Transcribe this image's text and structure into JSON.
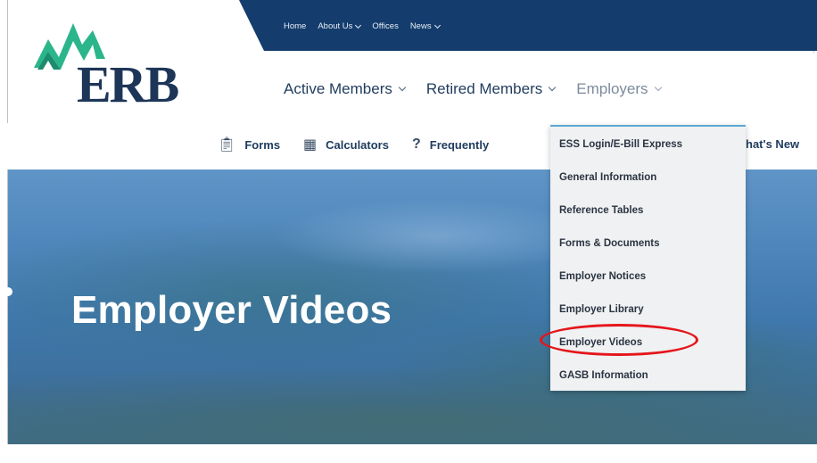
{
  "logo": {
    "text": "ERB",
    "peak_colors": [
      "#2bb58a",
      "#1d8c6e"
    ],
    "text_color": "#1d3557"
  },
  "utility_nav": [
    {
      "label": "Home",
      "has_dropdown": false
    },
    {
      "label": "About Us",
      "has_dropdown": true
    },
    {
      "label": "Offices",
      "has_dropdown": false
    },
    {
      "label": "News",
      "has_dropdown": true
    }
  ],
  "main_nav": [
    {
      "label": "Active Members",
      "has_dropdown": true
    },
    {
      "label": "Retired Members",
      "has_dropdown": true
    },
    {
      "label": "Employers",
      "has_dropdown": true,
      "state": "open"
    }
  ],
  "quick_links": [
    {
      "label": "Forms",
      "icon": "clipboard-icon"
    },
    {
      "label": "Calculators",
      "icon": "calculator-icon"
    },
    {
      "label": "Frequently",
      "icon": "question-icon"
    }
  ],
  "whats_new_partial": "hat's New",
  "hero": {
    "title": "Employer Videos"
  },
  "employers_menu": [
    "ESS Login/E-Bill Express",
    "General Information",
    "Reference Tables",
    "Forms & Documents",
    "Employer Notices",
    "Employer Library",
    "Employer Videos",
    "GASB Information"
  ],
  "annotation": {
    "circled_item": "Employer Videos",
    "color": "#e4161b"
  },
  "colors": {
    "utility_bar": "#143d6d",
    "nav_text": "#1f3b5e",
    "menu_bg": "#f0f1f2",
    "menu_accent": "#5aa9d6"
  }
}
